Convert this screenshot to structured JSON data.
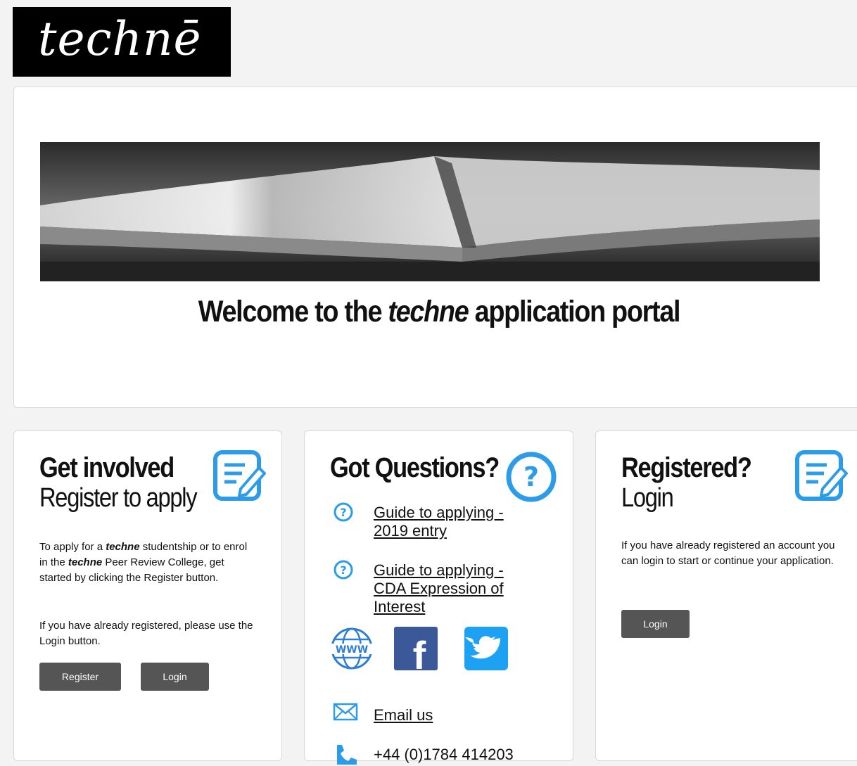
{
  "logo": {
    "text": "technē"
  },
  "hero": {
    "title_before": "Welcome to the ",
    "title_brand": "techne",
    "title_after": " application portal"
  },
  "register_panel": {
    "heading": "Get involved",
    "subheading": "Register to apply",
    "para1_a": "To apply for a ",
    "para1_brand1": "techne",
    "para1_b": " studentship or to enrol in the ",
    "para1_brand2": "techne",
    "para1_c": " Peer Review College, get started by clicking the Register button.",
    "para2": "If you have already registered, please use the Login button.",
    "register_label": "Register",
    "login_label": "Login",
    "icon": "edit-document-icon"
  },
  "questions_panel": {
    "heading": "Got Questions?",
    "icon": "question-circle-icon",
    "links": [
      {
        "label": "Guide to applying - 2019 entry",
        "icon": "question-circle-icon"
      },
      {
        "label": "Guide to applying - CDA Expression of Interest",
        "icon": "question-circle-icon"
      }
    ],
    "social": [
      {
        "name": "website",
        "icon": "www-globe-icon",
        "glyph": "WWW"
      },
      {
        "name": "facebook",
        "icon": "facebook-icon",
        "glyph": "f"
      },
      {
        "name": "twitter",
        "icon": "twitter-icon"
      }
    ],
    "email_label": "Email us",
    "phone": "+44 (0)1784 414203"
  },
  "login_panel": {
    "heading": "Registered?",
    "subheading": "Login",
    "para": "If you have already registered an account you can login to start or continue your application.",
    "login_label": "Login",
    "icon": "edit-document-icon"
  },
  "colors": {
    "accent": "#2d9ce8",
    "button": "#555555",
    "facebook": "#3b5998",
    "twitter": "#1da1f2"
  }
}
